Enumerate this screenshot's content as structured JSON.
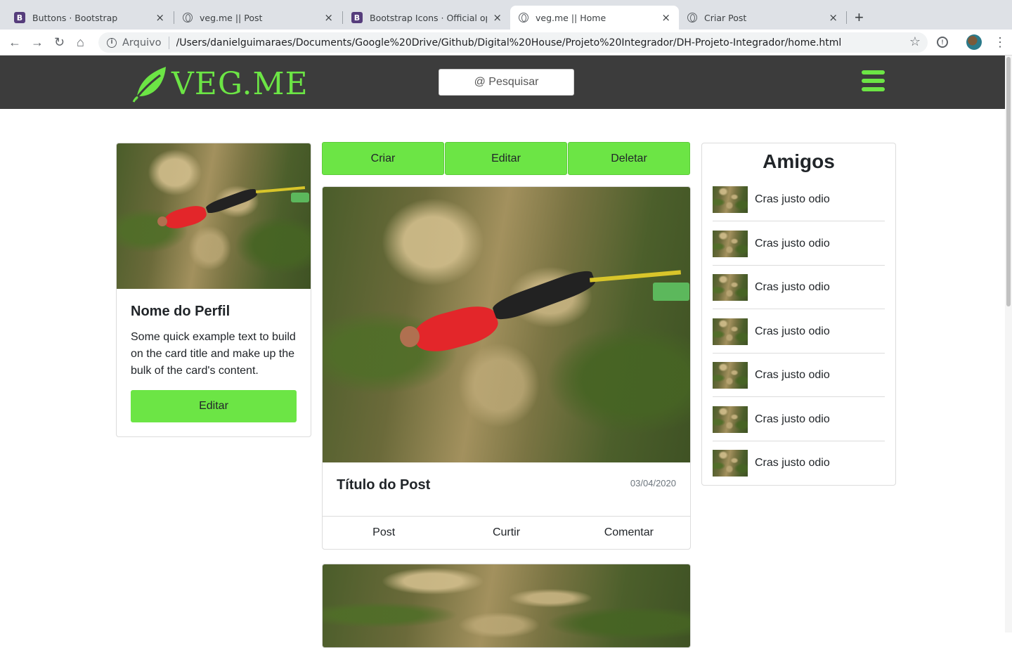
{
  "browser": {
    "tabs": [
      {
        "title": "Buttons · Bootstrap",
        "icon": "bootstrap-icon",
        "active": false
      },
      {
        "title": "veg.me || Post",
        "icon": "globe-icon",
        "active": false
      },
      {
        "title": "Bootstrap Icons · Official open",
        "icon": "bootstrap-icon",
        "active": false
      },
      {
        "title": "veg.me || Home",
        "icon": "globe-icon",
        "active": true
      },
      {
        "title": "Criar Post",
        "icon": "globe-icon",
        "active": false
      }
    ],
    "bootstrap_letter": "B",
    "close_glyph": "×",
    "new_tab_glyph": "+",
    "address": {
      "scheme_label": "Arquivo",
      "url": "/Users/danielguimaraes/Documents/Google%20Drive/Github/Digital%20House/Projeto%20Integrador/DH-Projeto-Integrador/home.html"
    }
  },
  "header": {
    "logo_text": "VEG.ME",
    "search_label": "@ Pesquisar",
    "accent_color": "#6ce545",
    "background_color": "#3c3c3c"
  },
  "profile": {
    "name": "Nome do Perfil",
    "text": "Some quick example text to build on the card title and make up the bulk of the card's content.",
    "edit_label": "Editar"
  },
  "actions": {
    "create_label": "Criar",
    "edit_label": "Editar",
    "delete_label": "Deletar"
  },
  "post": {
    "title": "Título do Post",
    "date": "03/04/2020",
    "footer": [
      "Post",
      "Curtir",
      "Comentar"
    ]
  },
  "friends": {
    "title": "Amigos",
    "items": [
      {
        "name": "Cras justo odio"
      },
      {
        "name": "Cras justo odio"
      },
      {
        "name": "Cras justo odio"
      },
      {
        "name": "Cras justo odio"
      },
      {
        "name": "Cras justo odio"
      },
      {
        "name": "Cras justo odio"
      },
      {
        "name": "Cras justo odio"
      }
    ]
  }
}
